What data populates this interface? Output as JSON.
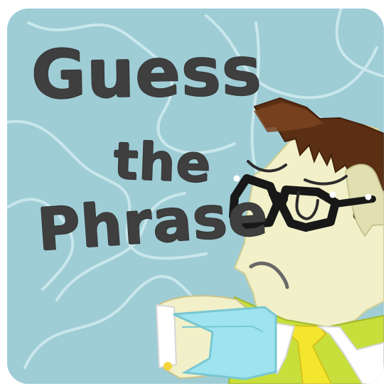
{
  "title": {
    "line1": "Guess",
    "line2": "the",
    "line3": "Phrase"
  },
  "colors": {
    "background": "#9fcdd6",
    "title": "#3f3f3f",
    "hair": "#5b2f14",
    "skin": "#f2f0c9",
    "jacket": "#c7df3b",
    "tie": "#f4e62d",
    "card": "#9fe3f0"
  },
  "icons": {
    "character": "man-with-glasses-icon",
    "decoration": "squiggle-lines-icon"
  }
}
